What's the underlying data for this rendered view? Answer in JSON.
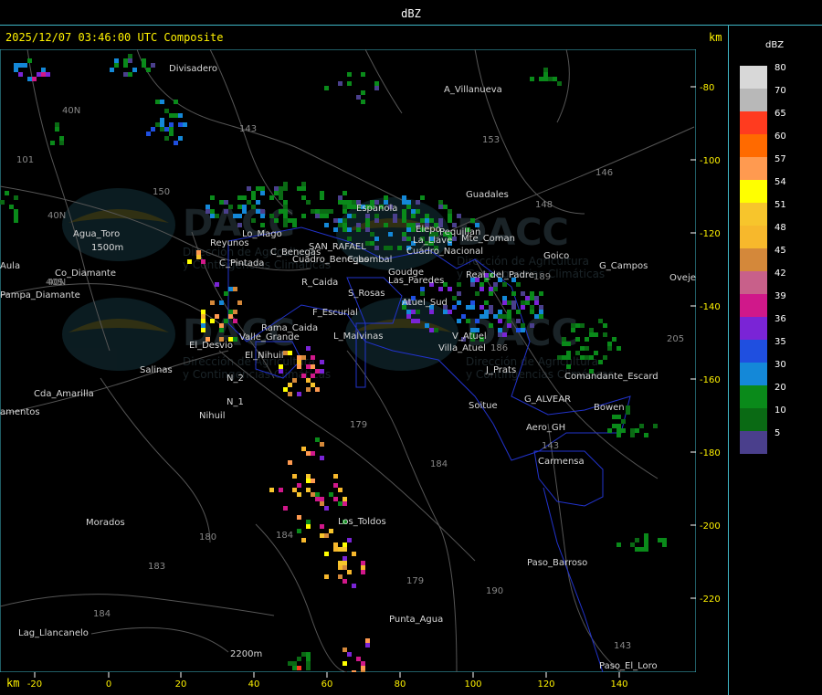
{
  "window": {
    "title": "dBZ"
  },
  "header": {
    "product": "2025/12/07 03:46:00 UTC Composite",
    "unit_top": "km",
    "unit_bottom": "km"
  },
  "legend": {
    "title": "dBZ",
    "entries": [
      {
        "value": "80",
        "color": "#d8d8d8"
      },
      {
        "value": "70",
        "color": "#b8b8b8"
      },
      {
        "value": "65",
        "color": "#ff3b1f"
      },
      {
        "value": "60",
        "color": "#ff6a00"
      },
      {
        "value": "57",
        "color": "#ff9a50"
      },
      {
        "value": "54",
        "color": "#ffff00"
      },
      {
        "value": "51",
        "color": "#f7c52c"
      },
      {
        "value": "48",
        "color": "#f7b82c"
      },
      {
        "value": "45",
        "color": "#d4883a"
      },
      {
        "value": "42",
        "color": "#c8608a"
      },
      {
        "value": "39",
        "color": "#d0188a"
      },
      {
        "value": "36",
        "color": "#7a24d6"
      },
      {
        "value": "35",
        "color": "#1f4fe0"
      },
      {
        "value": "30",
        "color": "#1488d8"
      },
      {
        "value": "20",
        "color": "#0a8a1a"
      },
      {
        "value": "10",
        "color": "#0a6a14"
      },
      {
        "value": "5",
        "color": "#4a3f8c"
      }
    ]
  },
  "axes": {
    "x_ticks": [
      "-20",
      "0",
      "20",
      "40",
      "60",
      "80",
      "100",
      "120",
      "140"
    ],
    "y_ticks": [
      "-80",
      "-100",
      "-120",
      "-140",
      "-160",
      "-180",
      "-200",
      "-220"
    ]
  },
  "places": [
    "Divisadero",
    "A_Villanueva",
    "Agua_Toro",
    "Pampa_Diamante",
    "El_Desvio",
    "Salinas",
    "Cda_Amarilla",
    "Nihuil",
    "Morados",
    "Lag_Llancanelo",
    "Punta_Agua",
    "Los_Toldos",
    "Guadales",
    "Goico",
    "G_Campos",
    "Ovejeria",
    "Soitue",
    "Bowen",
    "Carmensa",
    "Paso_Barroso",
    "Paso_El_Loro",
    "Aero_GH",
    "G_ALVEAR",
    "Comandante_Escard",
    "J_Prats",
    "V_Atuel",
    "Mte_Coman",
    "C_Pintada",
    "Reyunos",
    "Valle_Grande",
    "S_Rosas",
    "R_Caida",
    "F_Escurial",
    "L_Malvinas",
    "C_bombal",
    "SAN_RAFAEL",
    "Cuadro_Nacional",
    "Las_Paredes",
    "Atuel_Sud",
    "C_Benegas",
    "Goudge",
    "La_Llave",
    "El_Nihuil",
    "Rama_Caida",
    "Cuadro_Benegas",
    "Villa_Atuel",
    "Real_del_Padre",
    "Aula",
    "Pequillan",
    "Espanola",
    "Lo_Mago",
    "Elepo",
    "N_2",
    "N_1",
    "amentos",
    "1500m",
    "2200m",
    "Co_Diamante"
  ],
  "route_numbers": [
    "40N",
    "40N",
    "40S",
    "40N",
    "101",
    "143",
    "153",
    "146",
    "148",
    "150",
    "179",
    "184",
    "180",
    "184",
    "183",
    "184",
    "179",
    "190",
    "143",
    "143",
    "205",
    "189",
    "186"
  ],
  "watermark": {
    "brand": "DACC",
    "line1": "Dirección de Agricultura",
    "line2": "y Contingencias Climáticas"
  }
}
